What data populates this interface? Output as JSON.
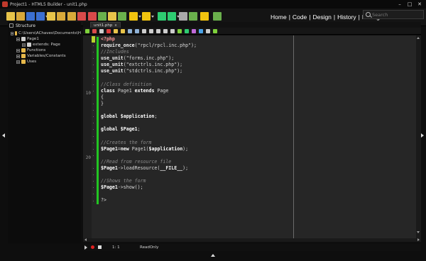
{
  "window": {
    "title": "Project1 - HTML5 Builder - unit1.php"
  },
  "topnav": {
    "items": [
      "Home",
      "Code",
      "Design",
      "History",
      "Debug"
    ],
    "separator": "|"
  },
  "search": {
    "placeholder": "Search"
  },
  "structure": {
    "title": "Structure",
    "tree": [
      {
        "label": "C:\\Users\\AChaves\\Documents\\H",
        "icon": "folder-icon",
        "depth": 0,
        "expanded": true
      },
      {
        "label": "Page1",
        "icon": "gear-icon",
        "depth": 1,
        "expanded": true
      },
      {
        "label": "extends: Page",
        "icon": "gear-icon",
        "depth": 2,
        "expanded": false
      },
      {
        "label": "Functions",
        "icon": "folder-icon",
        "depth": 1,
        "expanded": false
      },
      {
        "label": "Variables/Constants",
        "icon": "folder-icon",
        "depth": 1,
        "expanded": false
      },
      {
        "label": "Uses",
        "icon": "folder-icon",
        "depth": 1,
        "expanded": false
      }
    ]
  },
  "editor": {
    "tab_label": "unit1.php",
    "tab_close": "x",
    "line_markers": [
      "10",
      "20"
    ],
    "code_lines": [
      [
        {
          "t": "<?php",
          "c": "php"
        }
      ],
      [
        {
          "t": "require_once",
          "c": "fn"
        },
        {
          "t": "(\"rpcl/rpcl.inc.php\");",
          "c": "pl"
        }
      ],
      [
        {
          "t": "//Includes",
          "c": "cm"
        }
      ],
      [
        {
          "t": "use_unit",
          "c": "fn"
        },
        {
          "t": "(\"forms.inc.php\");",
          "c": "pl"
        }
      ],
      [
        {
          "t": "use_unit",
          "c": "fn"
        },
        {
          "t": "(\"extctrls.inc.php\");",
          "c": "pl"
        }
      ],
      [
        {
          "t": "use_unit",
          "c": "fn"
        },
        {
          "t": "(\"stdctrls.inc.php\");",
          "c": "pl"
        }
      ],
      [],
      [
        {
          "t": "//Class definition",
          "c": "cm"
        }
      ],
      [
        {
          "t": "class ",
          "c": "kw"
        },
        {
          "t": "Page1 ",
          "c": "pl"
        },
        {
          "t": "extends ",
          "c": "kw"
        },
        {
          "t": "Page",
          "c": "pl"
        }
      ],
      [
        {
          "t": "{",
          "c": "pl"
        }
      ],
      [
        {
          "t": "}",
          "c": "pl"
        }
      ],
      [],
      [
        {
          "t": "global ",
          "c": "kw"
        },
        {
          "t": "$application",
          "c": "var"
        },
        {
          "t": ";",
          "c": "pl"
        }
      ],
      [],
      [
        {
          "t": "global ",
          "c": "kw"
        },
        {
          "t": "$Page1",
          "c": "var"
        },
        {
          "t": ";",
          "c": "pl"
        }
      ],
      [],
      [
        {
          "t": "//Creates the form",
          "c": "cm"
        }
      ],
      [
        {
          "t": "$Page1",
          "c": "var"
        },
        {
          "t": "=",
          "c": "pl"
        },
        {
          "t": "new ",
          "c": "kw"
        },
        {
          "t": "Page1(",
          "c": "pl"
        },
        {
          "t": "$application",
          "c": "var"
        },
        {
          "t": ");",
          "c": "pl"
        }
      ],
      [],
      [
        {
          "t": "//Read from resource file",
          "c": "cm"
        }
      ],
      [
        {
          "t": "$Page1",
          "c": "var"
        },
        {
          "t": "->loadResource(",
          "c": "pl"
        },
        {
          "t": "__FILE__",
          "c": "fn"
        },
        {
          "t": ");",
          "c": "pl"
        }
      ],
      [],
      [
        {
          "t": "//Shows the form",
          "c": "cm"
        }
      ],
      [
        {
          "t": "$Page1",
          "c": "var"
        },
        {
          "t": "->show();",
          "c": "pl"
        }
      ],
      [],
      [
        {
          "t": "?>",
          "c": "pl"
        }
      ]
    ]
  },
  "statusbar": {
    "position": "1:  1",
    "mode": "ReadOnly"
  },
  "colors": {
    "background": "#0e0e0e",
    "editor_bg": "#262626",
    "change_bar": "#22c522",
    "accent_red": "#e02020"
  },
  "toolbar_icons": [
    {
      "name": "new-project-icon",
      "color": "#e8c44a"
    },
    {
      "name": "open-icon",
      "color": "#d9a93a"
    },
    {
      "name": "save-icon",
      "color": "#3b6fd1"
    },
    {
      "name": "save-all-icon",
      "color": "#3b6fd1"
    },
    {
      "name": "new-file-icon",
      "color": "#e8c44a"
    },
    {
      "name": "open-file-icon",
      "color": "#d9a93a"
    },
    {
      "name": "add-file-icon",
      "color": "#d9a93a"
    },
    {
      "name": "remove-file-icon",
      "color": "#d94a4a"
    },
    {
      "name": "cut-icon",
      "color": "#d94a4a"
    },
    {
      "name": "copy-icon",
      "color": "#6ab04c"
    },
    {
      "name": "paste-icon",
      "color": "#e8c44a"
    },
    {
      "name": "undo-icon",
      "color": "#6ab04c"
    },
    {
      "name": "run-icon",
      "color": "#f1c40f"
    },
    {
      "name": "run-debug-icon",
      "color": "#f1c40f"
    },
    {
      "name": "step-over-icon",
      "color": "#2ecc71"
    },
    {
      "name": "step-into-icon",
      "color": "#2ecc71"
    },
    {
      "name": "inspect-icon",
      "color": "#aaaaaa"
    },
    {
      "name": "deploy-icon",
      "color": "#6ab04c"
    },
    {
      "name": "build-icon",
      "color": "#f1c40f"
    },
    {
      "name": "settings-icon",
      "color": "#6ab04c"
    }
  ],
  "edit_toolbar_icons": [
    {
      "name": "refresh-icon",
      "color": "#7fd13b"
    },
    {
      "name": "pointer-icon",
      "color": "#d94a4a"
    },
    {
      "name": "page-icon",
      "color": "#cccccc"
    },
    {
      "name": "delete-icon",
      "color": "#e03c3c"
    },
    {
      "name": "doc-icon",
      "color": "#e8c44a"
    },
    {
      "name": "doc2-icon",
      "color": "#e8c44a"
    },
    {
      "name": "find-icon",
      "color": "#8fb3d9"
    },
    {
      "name": "find-next-icon",
      "color": "#8fb3d9"
    },
    {
      "name": "replace-icon",
      "color": "#cccccc"
    },
    {
      "name": "goto-icon",
      "color": "#cccccc"
    },
    {
      "name": "bookmark-icon",
      "color": "#cccccc"
    },
    {
      "name": "bookmark-next-icon",
      "color": "#cccccc"
    },
    {
      "name": "indent-icon",
      "color": "#cccccc"
    },
    {
      "name": "comment-icon",
      "color": "#7fd13b"
    },
    {
      "name": "record-icon",
      "color": "#2ecc71"
    },
    {
      "name": "palette-icon",
      "color": "#c06ad9"
    },
    {
      "name": "color-icon",
      "color": "#4aa3e8"
    },
    {
      "name": "check-icon",
      "color": "#cccccc"
    },
    {
      "name": "help-icon",
      "color": "#7fd13b"
    }
  ]
}
